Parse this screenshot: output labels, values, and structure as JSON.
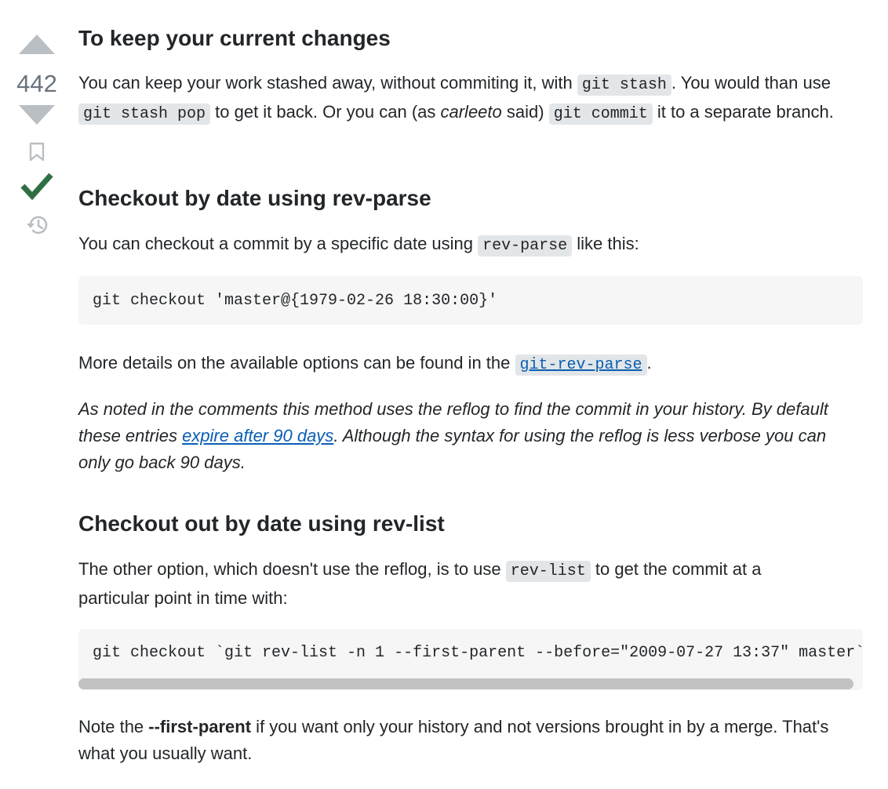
{
  "vote": {
    "score": "442",
    "icons": {
      "upvote": "triangle-up-icon",
      "downvote": "triangle-down-icon",
      "bookmark": "bookmark-icon",
      "accepted": "checkmark-icon",
      "history": "history-icon"
    },
    "colors": {
      "arrow": "#babfc4",
      "accepted": "#2f6f44",
      "muted": "#babfc4"
    }
  },
  "sections": {
    "keep": {
      "heading": "To keep your current changes",
      "p1": {
        "t1": "You can keep your work stashed away, without commiting it, with ",
        "c1": "git stash",
        "t2": ". You would than use ",
        "c2": "git stash pop",
        "t3": " to get it back. Or you can (as ",
        "em": "carleeto",
        "t4": " said) ",
        "c3": "git commit",
        "t5": " it to a separate branch."
      }
    },
    "revparse": {
      "heading": "Checkout by date using rev-parse",
      "p1": {
        "t1": "You can checkout a commit by a specific date using ",
        "c1": "rev-parse",
        "t2": " like this:"
      },
      "code": "git checkout 'master@{1979-02-26 18:30:00}'",
      "p2": {
        "t1": "More details on the available options can be found in the ",
        "link": "git-rev-parse",
        "t2": "."
      },
      "p3": {
        "t1": "As noted in the comments this method uses the reflog to find the commit in your history. By default these entries ",
        "link": "expire after 90 days",
        "t2": ". Although the syntax for using the reflog is less verbose you can only go back 90 days."
      }
    },
    "revlist": {
      "heading": "Checkout out by date using rev-list",
      "p1": {
        "t1": "The other option, which doesn't use the reflog, is to use ",
        "c1": "rev-list",
        "t2": " to get the commit at a particular point in time with:"
      },
      "code": "git checkout `git rev-list -n 1 --first-parent --before=\"2009-07-27 13:37\" master`",
      "p2": {
        "t1": "Note the ",
        "strong": "--first-parent",
        "t2": " if you want only your history and not versions brought in by a merge. That's what you usually want."
      }
    }
  }
}
